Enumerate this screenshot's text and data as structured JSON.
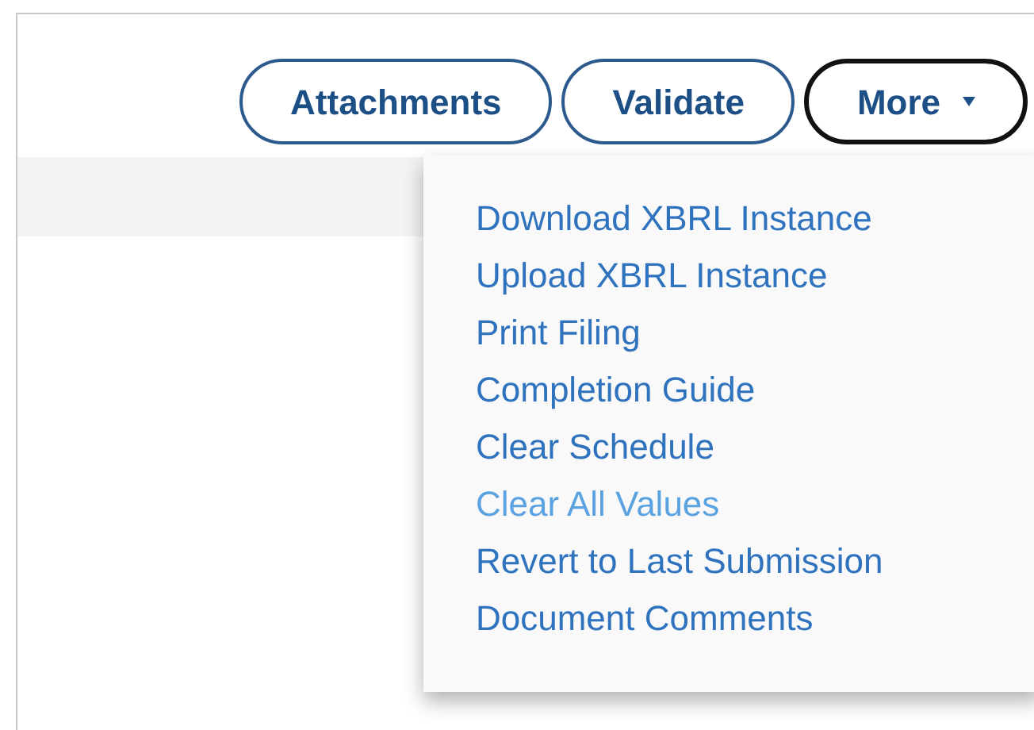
{
  "toolbar": {
    "buttons": [
      {
        "label": "Attachments",
        "focused": false
      },
      {
        "label": "Validate",
        "focused": false
      },
      {
        "label": "More",
        "focused": true,
        "kind": "dropdown"
      }
    ]
  },
  "more_menu": {
    "items": [
      {
        "label": "Download XBRL Instance",
        "highlighted": false
      },
      {
        "label": "Upload XBRL Instance",
        "highlighted": false
      },
      {
        "label": "Print Filing",
        "highlighted": false
      },
      {
        "label": "Completion Guide",
        "highlighted": false
      },
      {
        "label": "Clear Schedule",
        "highlighted": false
      },
      {
        "label": "Clear All Values",
        "highlighted": true
      },
      {
        "label": "Revert to Last Submission",
        "highlighted": false
      },
      {
        "label": "Document Comments",
        "highlighted": false
      }
    ]
  }
}
